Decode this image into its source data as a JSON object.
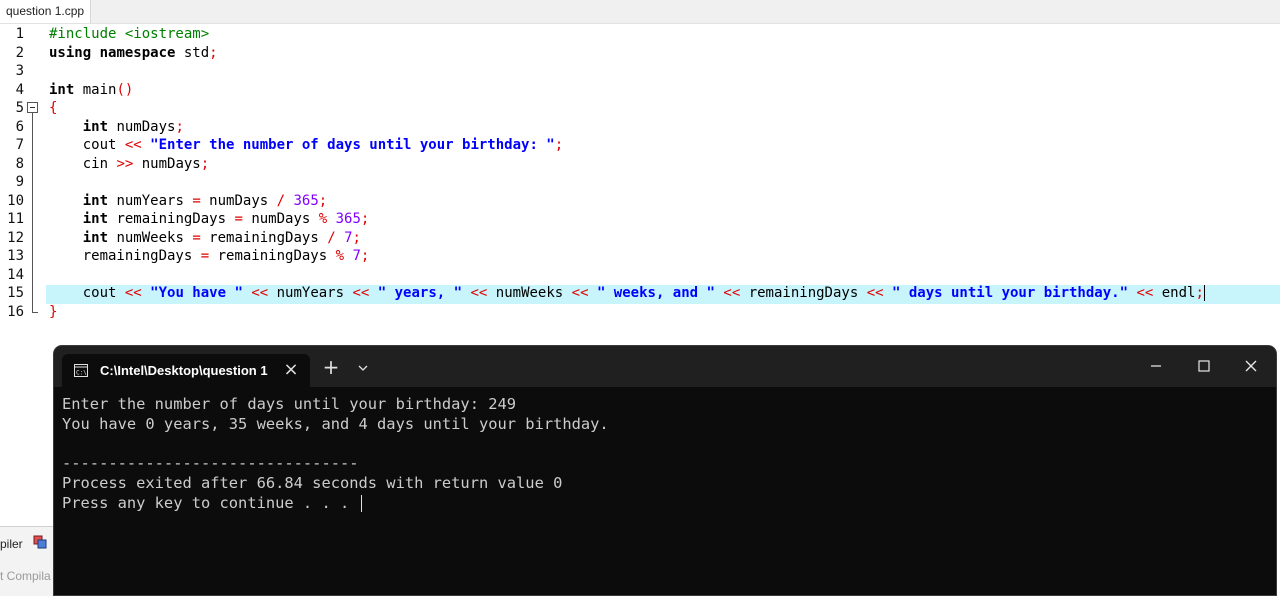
{
  "editor": {
    "tab_label": "question 1.cpp",
    "line_numbers": [
      "1",
      "2",
      "3",
      "4",
      "5",
      "6",
      "7",
      "8",
      "9",
      "10",
      "11",
      "12",
      "13",
      "14",
      "15",
      "16"
    ],
    "lines": [
      [
        "#include <iostream>"
      ],
      [
        "using",
        " ",
        "namespace",
        " std",
        ";"
      ],
      [
        ""
      ],
      [
        "int",
        " main",
        "()"
      ],
      [
        "{"
      ],
      [
        "    ",
        "int",
        " numDays",
        ";"
      ],
      [
        "    cout ",
        "<<",
        " ",
        "\"Enter the number of days until your birthday: \"",
        ";"
      ],
      [
        "    cin ",
        ">>",
        " numDays",
        ";"
      ],
      [
        ""
      ],
      [
        "    ",
        "int",
        " numYears ",
        "=",
        " numDays ",
        "/",
        " ",
        "365",
        ";"
      ],
      [
        "    ",
        "int",
        " remainingDays ",
        "=",
        " numDays ",
        "%",
        " ",
        "365",
        ";"
      ],
      [
        "    ",
        "int",
        " numWeeks ",
        "=",
        " remainingDays ",
        "/",
        " ",
        "7",
        ";"
      ],
      [
        "    remainingDays ",
        "=",
        " remainingDays ",
        "%",
        " ",
        "7",
        ";"
      ],
      [
        ""
      ],
      [
        "    cout ",
        "<<",
        " ",
        "\"You have \"",
        " ",
        "<<",
        " numYears ",
        "<<",
        " ",
        "\" years, \"",
        " ",
        "<<",
        " numWeeks ",
        "<<",
        " ",
        "\" weeks, and \"",
        " ",
        "<<",
        " remainingDays ",
        "<<",
        " ",
        "\" days until your birthday.\"",
        " ",
        "<<",
        " endl",
        ";"
      ],
      [
        "}"
      ]
    ]
  },
  "bottom_panel": {
    "compiler_label": "piler",
    "compile_tab_label": "t Compila"
  },
  "terminal": {
    "tab_title": "C:\\Intel\\Desktop\\question 1",
    "close_tab_glyph": "×",
    "new_tab_glyph": "+",
    "output_lines": [
      "Enter the number of days until your birthday: 249",
      "You have 0 years, 35 weeks, and 4 days until your birthday.",
      "",
      "--------------------------------",
      "Process exited after 66.84 seconds with return value 0",
      "Press any key to continue . . . "
    ],
    "background_color": "#0c0c0c"
  },
  "colors": {
    "current_line_highlight": "#c8f5fb",
    "string": "#0000ff",
    "operator": "#e00000",
    "number": "#8000ff",
    "preprocessor": "#008000"
  }
}
